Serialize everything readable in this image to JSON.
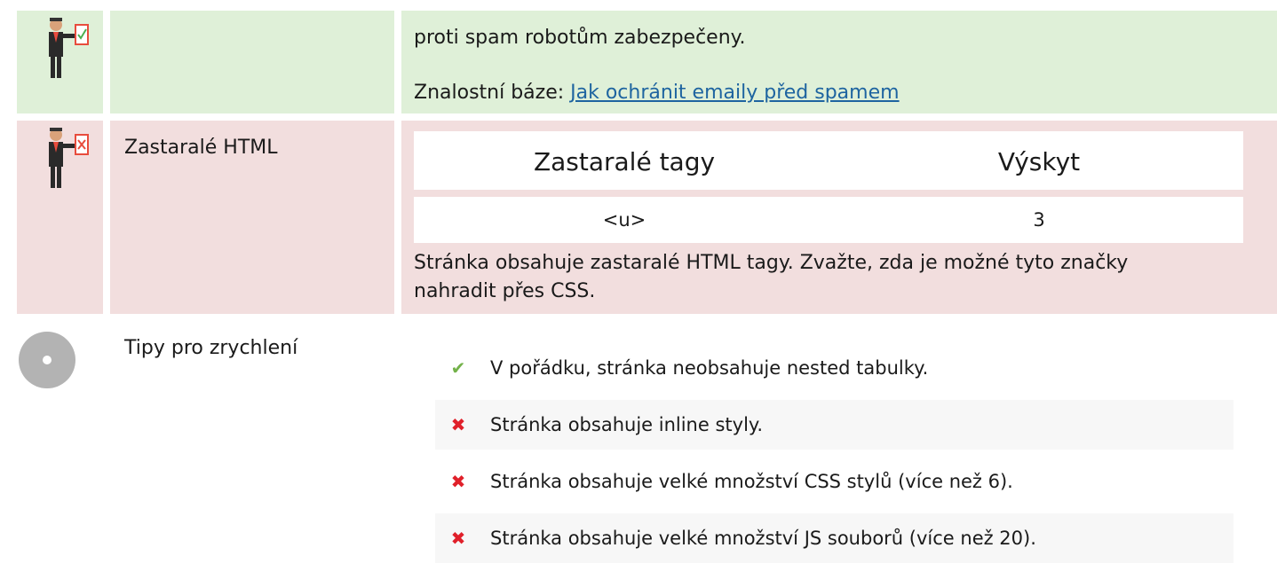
{
  "row1": {
    "text_line1": "proti spam robotům zabezpečeny.",
    "kb_label": "Znalostní báze: ",
    "kb_link": "Jak ochránit emaily před spamem",
    "status": "ok"
  },
  "row2": {
    "label": "Zastaralé HTML",
    "status": "fail",
    "table": {
      "headers": [
        "Zastaralé tagy",
        "Výskyt"
      ],
      "rows": [
        [
          "<u>",
          "3"
        ]
      ]
    },
    "note": "Stránka obsahuje zastaralé HTML tagy. Zvažte, zda je možné tyto značky nahradit přes CSS."
  },
  "row3": {
    "label": "Tipy pro zrychlení",
    "tips": [
      {
        "status": "ok",
        "icon": "check-icon",
        "text": "V pořádku, stránka neobsahuje nested tabulky."
      },
      {
        "status": "fail",
        "icon": "cross-icon",
        "text": "Stránka obsahuje inline styly."
      },
      {
        "status": "fail",
        "icon": "cross-icon",
        "text": "Stránka obsahuje velké množství CSS stylů (více než 6)."
      },
      {
        "status": "fail",
        "icon": "cross-icon",
        "text": "Stránka obsahuje velké množství JS souborů (více než 20)."
      }
    ]
  },
  "colors": {
    "ok_bg": "#dff0d8",
    "fail_bg": "#f2dede",
    "link": "#1e64a0",
    "check": "#73b24a",
    "cross": "#e0202a"
  }
}
